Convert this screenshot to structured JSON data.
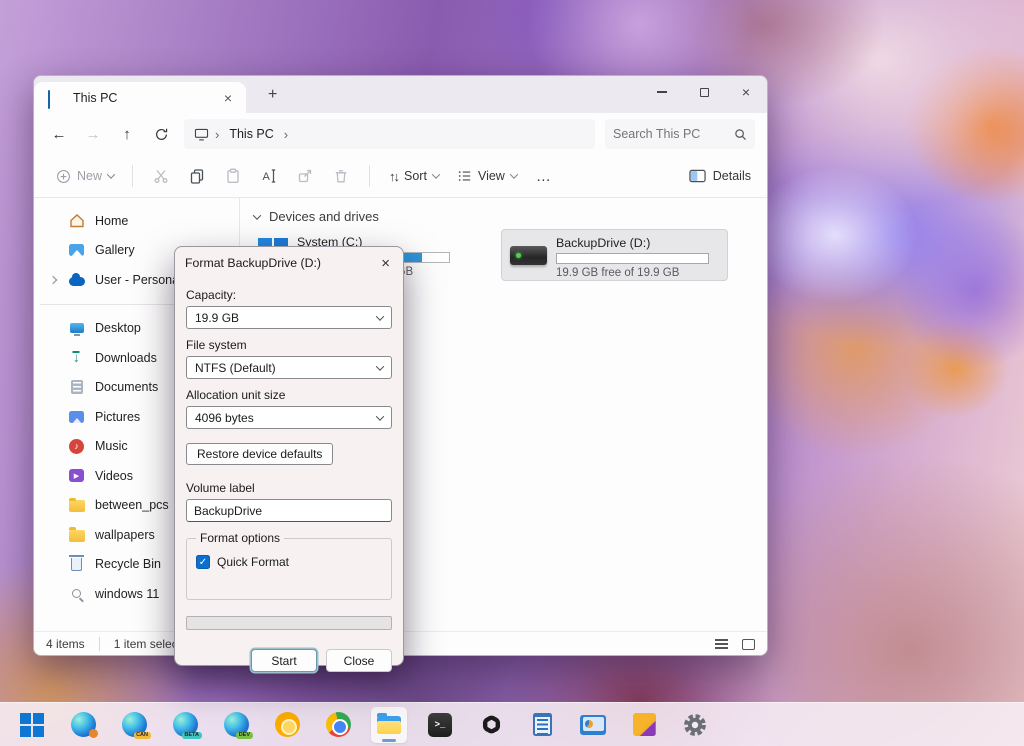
{
  "colors": {
    "accent": "#0f6cbd",
    "capacity_bar_blue": "#2e95d9",
    "checkbox_blue": "#0b6fd0",
    "selection_gray": "#e7e7ea"
  },
  "tab": {
    "title": "This PC"
  },
  "nav": {
    "breadcrumb_root": "This PC",
    "search_placeholder": "Search This PC"
  },
  "toolbar": {
    "new": "New",
    "sort": "Sort",
    "view": "View",
    "more": "…",
    "details": "Details"
  },
  "sidebar": {
    "items": [
      {
        "label": "Home",
        "icon": "home-icon"
      },
      {
        "label": "Gallery",
        "icon": "gallery-icon"
      },
      {
        "label": "User - Personal",
        "icon": "onedrive-cloud-icon"
      },
      {
        "label": "Desktop",
        "icon": "desktop-icon"
      },
      {
        "label": "Downloads",
        "icon": "downloads-icon"
      },
      {
        "label": "Documents",
        "icon": "documents-icon"
      },
      {
        "label": "Pictures",
        "icon": "pictures-icon"
      },
      {
        "label": "Music",
        "icon": "music-icon"
      },
      {
        "label": "Videos",
        "icon": "videos-icon"
      },
      {
        "label": "between_pcs",
        "icon": "folder-icon"
      },
      {
        "label": "wallpapers",
        "icon": "folder-icon"
      },
      {
        "label": "Recycle Bin",
        "icon": "recycle-bin-icon"
      },
      {
        "label": "windows 11",
        "icon": "saved-search-icon"
      }
    ]
  },
  "content": {
    "section_title": "Devices and drives",
    "drives": [
      {
        "name": "System (C:)",
        "free": "2 GB",
        "fill": "82%"
      },
      {
        "name": "BackupDrive (D:)",
        "free": "19.9 GB free of 19.9 GB",
        "fill": "0%"
      }
    ]
  },
  "statusbar": {
    "count": "4 items",
    "selected": "1 item selected"
  },
  "dialog": {
    "title": "Format BackupDrive (D:)",
    "capacity_label": "Capacity:",
    "capacity_value": "19.9 GB",
    "filesystem_label": "File system",
    "filesystem_value": "NTFS (Default)",
    "allocation_label": "Allocation unit size",
    "allocation_value": "4096 bytes",
    "restore_button": "Restore device defaults",
    "volume_label": "Volume label",
    "volume_value": "BackupDrive",
    "group_label": "Format options",
    "quick_format": "Quick Format",
    "quick_format_checked": true,
    "start": "Start",
    "close": "Close"
  },
  "glyphs": {
    "back": "←",
    "forward": "→",
    "up": "↑",
    "breadcrumb_sep": "›",
    "close": "×",
    "check": "✓",
    "sort": "↑↓",
    "new_plus": "+",
    "newtab_plus": "+",
    "music_note": "♪",
    "video_play": "▶",
    "terminal_prompt": ">_"
  },
  "taskbar": {
    "apps": [
      "start",
      "edge",
      "edge-canary",
      "edge-beta",
      "edge-dev",
      "chrome-canary",
      "chrome",
      "file-explorer",
      "terminal",
      "chatgpt",
      "notepad",
      "system-monitor",
      "paint",
      "settings"
    ],
    "badges": {
      "canary": "CAN",
      "beta": "BETA",
      "dev": "DEV"
    }
  }
}
